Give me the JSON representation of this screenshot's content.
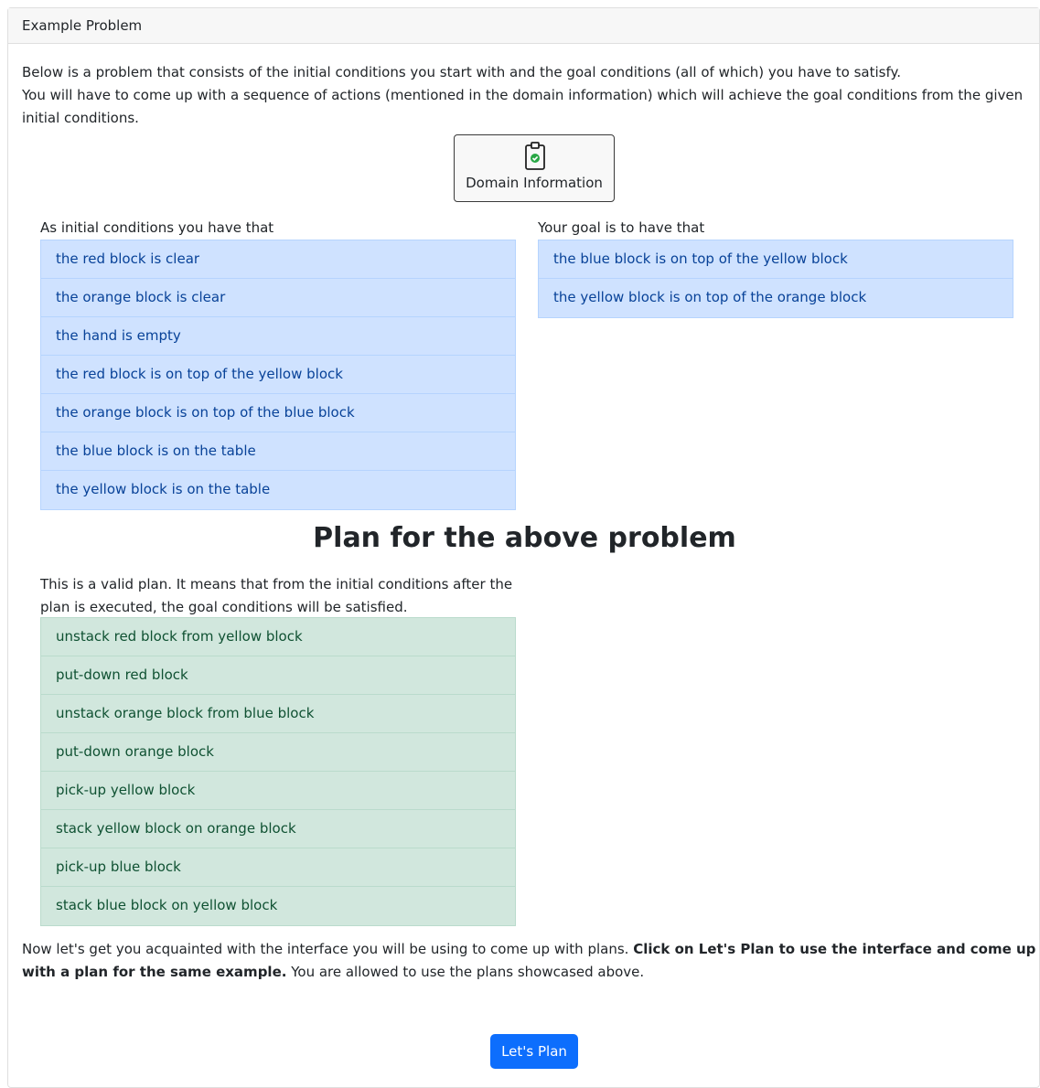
{
  "header": {
    "title": "Example Problem"
  },
  "intro": {
    "line1": "Below is a problem that consists of the initial conditions you start with and the goal conditions (all of which) you have to satisfy.",
    "line2": "You will have to come up with a sequence of actions (mentioned in the domain information) which will achieve the goal conditions from the given initial conditions."
  },
  "domain_button": {
    "label": "Domain Information",
    "icon": "clipboard-check-icon"
  },
  "initial": {
    "label": "As initial conditions you have that",
    "items": [
      "the red block is clear",
      "the orange block is clear",
      "the hand is empty",
      "the red block is on top of the yellow block",
      "the orange block is on top of the blue block",
      "the blue block is on the table",
      "the yellow block is on the table"
    ]
  },
  "goal": {
    "label": "Your goal is to have that",
    "items": [
      "the blue block is on top of the yellow block",
      "the yellow block is on top of the orange block"
    ]
  },
  "plan": {
    "title": "Plan for the above problem",
    "description": "This is a valid plan. It means that from the initial conditions after the plan is executed, the goal conditions will be satisfied.",
    "steps": [
      "unstack red block from yellow block",
      "put-down red block",
      "unstack orange block from blue block",
      "put-down orange block",
      "pick-up yellow block",
      "stack yellow block on orange block",
      "pick-up blue block",
      "stack blue block on yellow block"
    ]
  },
  "outro": {
    "text_before": "Now let's get you acquainted with the interface you will be using to come up with plans. ",
    "text_bold": "Click on Let's Plan to use the interface and come up with a plan for the same example.",
    "text_after": " You are allowed to use the plans showcased above."
  },
  "plan_button": {
    "label": "Let's Plan"
  },
  "colors": {
    "primary": "#0d6efd",
    "info_bg": "#cfe2ff",
    "info_text": "#084298",
    "success_bg": "#d1e7dd",
    "success_text": "#0f5132",
    "icon_green": "#28a745"
  }
}
